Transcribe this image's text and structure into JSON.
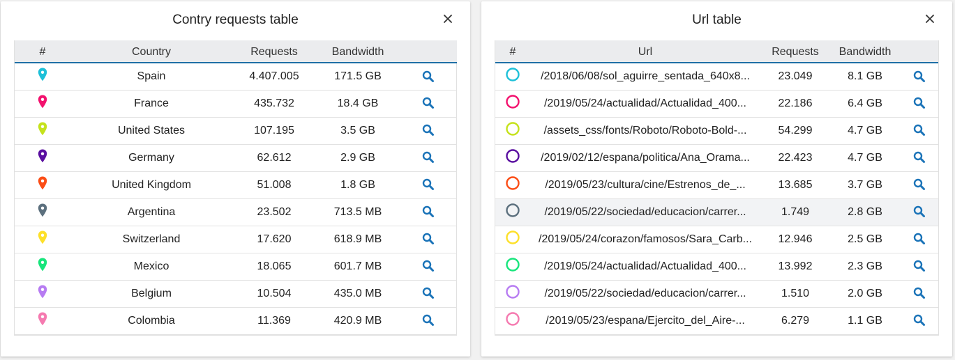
{
  "country_panel": {
    "title": "Contry requests table",
    "columns": [
      "#",
      "Country",
      "Requests",
      "Bandwidth",
      ""
    ],
    "rows": [
      {
        "color": "#1ec0d8",
        "country": "Spain",
        "requests": "4.407.005",
        "bandwidth": "171.5 GB"
      },
      {
        "color": "#f3126e",
        "country": "France",
        "requests": "435.732",
        "bandwidth": "18.4 GB"
      },
      {
        "color": "#c5e21c",
        "country": "United States",
        "requests": "107.195",
        "bandwidth": "3.5 GB"
      },
      {
        "color": "#5a0fa0",
        "country": "Germany",
        "requests": "62.612",
        "bandwidth": "2.9 GB"
      },
      {
        "color": "#fb4d16",
        "country": "United Kingdom",
        "requests": "51.008",
        "bandwidth": "1.8 GB"
      },
      {
        "color": "#5c707e",
        "country": "Argentina",
        "requests": "23.502",
        "bandwidth": "713.5 MB"
      },
      {
        "color": "#fde02a",
        "country": "Switzerland",
        "requests": "17.620",
        "bandwidth": "618.9 MB"
      },
      {
        "color": "#18e57c",
        "country": "Mexico",
        "requests": "18.065",
        "bandwidth": "601.7 MB"
      },
      {
        "color": "#b77cf2",
        "country": "Belgium",
        "requests": "10.504",
        "bandwidth": "435.0 MB"
      },
      {
        "color": "#f57ab0",
        "country": "Colombia",
        "requests": "11.369",
        "bandwidth": "420.9 MB"
      }
    ]
  },
  "url_panel": {
    "title": "Url table",
    "columns": [
      "#",
      "Url",
      "Requests",
      "Bandwidth",
      ""
    ],
    "rows": [
      {
        "color": "#1ec0d8",
        "url": "/2018/06/08/sol_aguirre_sentada_640x8...",
        "requests": "23.049",
        "bandwidth": "8.1 GB"
      },
      {
        "color": "#f3126e",
        "url": "/2019/05/24/actualidad/Actualidad_400...",
        "requests": "22.186",
        "bandwidth": "6.4 GB"
      },
      {
        "color": "#c5e21c",
        "url": "/assets_css/fonts/Roboto/Roboto-Bold-...",
        "requests": "54.299",
        "bandwidth": "4.7 GB"
      },
      {
        "color": "#5a0fa0",
        "url": "/2019/02/12/espana/politica/Ana_Orama...",
        "requests": "22.423",
        "bandwidth": "4.7 GB"
      },
      {
        "color": "#fb4d16",
        "url": "/2019/05/23/cultura/cine/Estrenos_de_...",
        "requests": "13.685",
        "bandwidth": "3.7 GB"
      },
      {
        "color": "#5c707e",
        "url": "/2019/05/22/sociedad/educacion/carrer...",
        "requests": "1.749",
        "bandwidth": "2.8 GB"
      },
      {
        "color": "#fde02a",
        "url": "/2019/05/24/corazon/famosos/Sara_Carb...",
        "requests": "12.946",
        "bandwidth": "2.5 GB"
      },
      {
        "color": "#18e57c",
        "url": "/2019/05/24/actualidad/Actualidad_400...",
        "requests": "13.992",
        "bandwidth": "2.3 GB"
      },
      {
        "color": "#b77cf2",
        "url": "/2019/05/22/sociedad/educacion/carrer...",
        "requests": "1.510",
        "bandwidth": "2.0 GB"
      },
      {
        "color": "#f57ab0",
        "url": "/2019/05/23/espana/Ejercito_del_Aire-...",
        "requests": "6.279",
        "bandwidth": "1.1 GB"
      }
    ]
  },
  "icons": {
    "close": "close-icon",
    "search": "search-icon",
    "country_marker": "map-pin-icon",
    "url_marker": "circle-icon"
  },
  "colors": {
    "accent": "#1f6fa6",
    "search_icon": "#1a73b8",
    "header_bg": "#ebecee"
  }
}
